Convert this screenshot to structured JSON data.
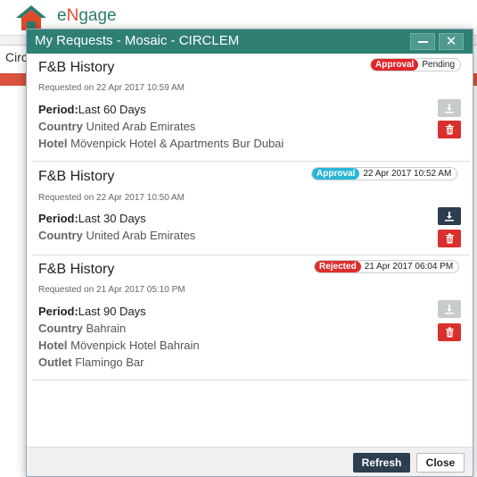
{
  "app": {
    "brand_prefix": "e",
    "brand_n": "N",
    "brand_suffix": "gage",
    "bg_tab": "Circ"
  },
  "dialog": {
    "title": "My Requests - Mosaic - CIRCLEM",
    "minimize_icon": "minimize-icon",
    "close_icon": "close-icon",
    "requests": [
      {
        "title": "F&B History",
        "requested": "Requested on 22 Apr 2017 10:59 AM",
        "badge": "Approval",
        "badge_color": "#e0262b",
        "status_text": "Pending",
        "period_key": "Period:",
        "period_val": "Last 60 Days",
        "country_key": "Country",
        "country_val": "United Arab Emirates",
        "hotel_key": "Hotel",
        "hotel_val": "Mövenpick Hotel & Apartments Bur Dubai",
        "download_enabled": false
      },
      {
        "title": "F&B History",
        "requested": "Requested on 22 Apr 2017 10:50 AM",
        "badge": "Approval",
        "badge_color": "#29b6d6",
        "status_text": "22 Apr 2017 10:52 AM",
        "period_key": "Period:",
        "period_val": "Last 30 Days",
        "country_key": "Country",
        "country_val": "United Arab Emirates",
        "download_enabled": true
      },
      {
        "title": "F&B History",
        "requested": "Requested on 21 Apr 2017 05:10 PM",
        "badge": "Rejected",
        "badge_color": "#d9302e",
        "status_text": "21 Apr 2017 06:04 PM",
        "period_key": "Period:",
        "period_val": "Last 90 Days",
        "country_key": "Country",
        "country_val": "Bahrain",
        "hotel_key": "Hotel",
        "hotel_val": "Mövenpick Hotel Bahrain",
        "outlet_key": "Outlet",
        "outlet_val": "Flamingo Bar",
        "download_enabled": false
      }
    ],
    "footer": {
      "refresh_label": "Refresh",
      "close_label": "Close"
    }
  }
}
